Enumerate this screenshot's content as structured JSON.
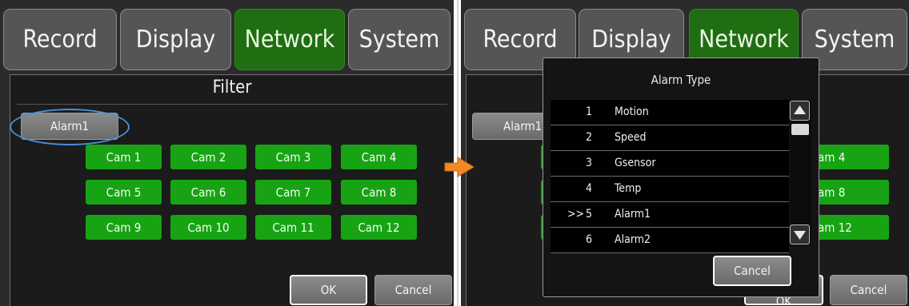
{
  "left": {
    "tabs": [
      "Record",
      "Display",
      "Network",
      "System"
    ],
    "filter_title": "Filter",
    "alarm_button": "Alarm1",
    "cams": [
      "Cam 1",
      "Cam 2",
      "Cam 3",
      "Cam 4",
      "Cam 5",
      "Cam 6",
      "Cam 7",
      "Cam 8",
      "Cam 9",
      "Cam 10",
      "Cam 11",
      "Cam 12"
    ],
    "ok_label": "OK",
    "cancel_label": "Cancel"
  },
  "right": {
    "tabs": [
      "Record",
      "Display",
      "Network",
      "System"
    ],
    "alarm_button": "Alarm1",
    "cams_visible": [
      "am 4",
      "am 8",
      "am 12"
    ],
    "cancel_label": "Cancel",
    "ok_partial": "OK",
    "dialog": {
      "title": "Alarm Type",
      "rows": [
        {
          "mark": "",
          "num": "1",
          "label": "Motion"
        },
        {
          "mark": "",
          "num": "2",
          "label": "Speed"
        },
        {
          "mark": "",
          "num": "3",
          "label": "Gsensor"
        },
        {
          "mark": "",
          "num": "4",
          "label": "Temp"
        },
        {
          "mark": ">>",
          "num": "5",
          "label": "Alarm1"
        },
        {
          "mark": "",
          "num": "6",
          "label": "Alarm2"
        }
      ],
      "cancel_label": "Cancel"
    }
  },
  "colors": {
    "active_tab": "#1f6e12",
    "cam_green": "#17a314",
    "highlight_ellipse": "#4a8fd6",
    "arrow": "#f08a24"
  },
  "icons": {
    "transition_arrow": "arrow-right-icon",
    "scroll_up": "scroll-up-icon",
    "scroll_down": "scroll-down-icon"
  }
}
